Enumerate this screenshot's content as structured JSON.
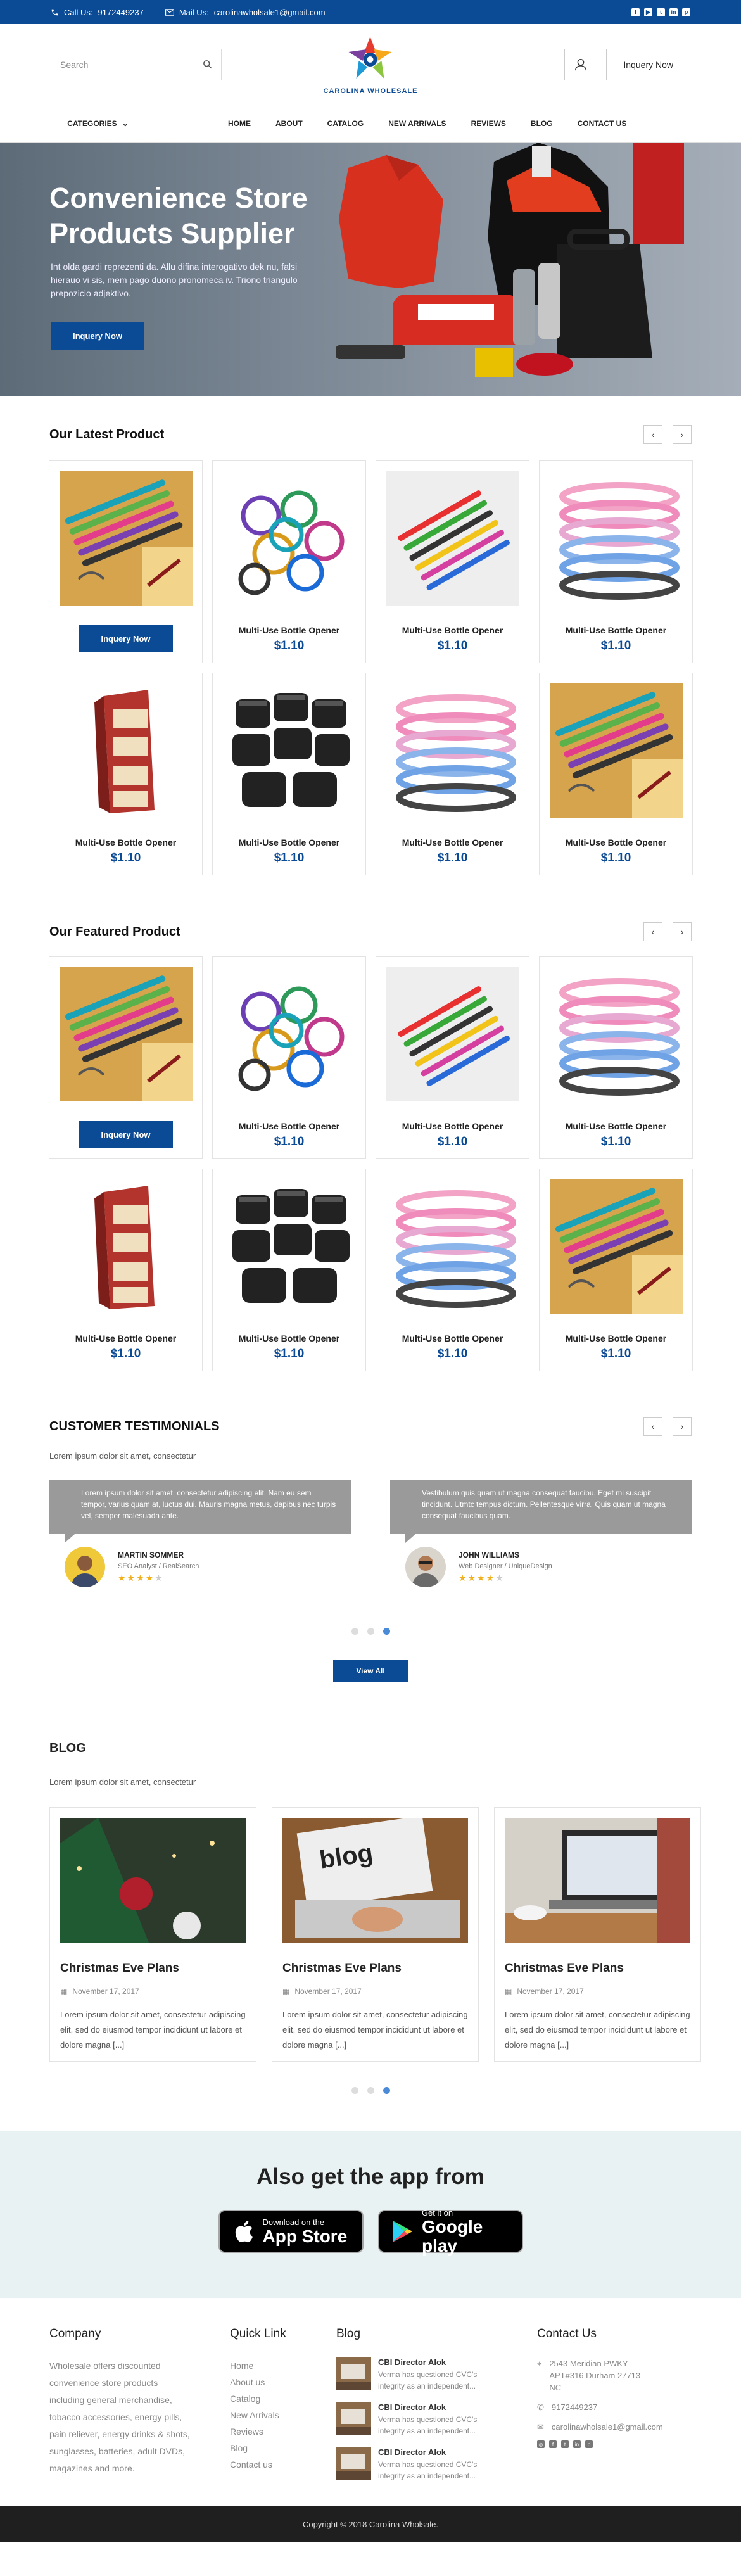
{
  "topbar": {
    "call_label": "Call Us:",
    "phone": "9172449237",
    "mail_label": "Mail Us:",
    "email": "carolinawholsale1@gmail.com",
    "social": [
      "f",
      "▶",
      "t",
      "in",
      "p"
    ]
  },
  "header": {
    "search_placeholder": "Search",
    "logo_text": "CAROLINA WHOLESALE",
    "inquiry_label": "Inquery Now"
  },
  "nav": {
    "categories": "CATEGORIES",
    "links": [
      "HOME",
      "ABOUT",
      "CATALOG",
      "NEW ARRIVALS",
      "REVIEWS",
      "BLOG",
      "CONTACT US"
    ]
  },
  "hero": {
    "title": "Convenience Store Products Supplier",
    "text": "Int olda gardi reprezenti da. Allu difina interogativo dek nu, falsi hierauo vi sis, mem pago duono pronomeca iv. Triono triangulo prepozicio adjektivo.",
    "button": "Inquery Now"
  },
  "latest": {
    "title": "Our Latest Product",
    "prev": "‹",
    "next": "›",
    "products": [
      {
        "name": "",
        "price": "",
        "button": "Inquery Now",
        "img": "openers-teal"
      },
      {
        "name": "Multi-Use Bottle Opener",
        "price": "$1.10",
        "img": "rings"
      },
      {
        "name": "Multi-Use Bottle Opener",
        "price": "$1.10",
        "img": "openers-white"
      },
      {
        "name": "Multi-Use Bottle Opener",
        "price": "$1.10",
        "img": "coils-pink"
      },
      {
        "name": "Multi-Use Bottle Opener",
        "price": "$1.10",
        "img": "box-display"
      },
      {
        "name": "Multi-Use Bottle Opener",
        "price": "$1.10",
        "img": "jars"
      },
      {
        "name": "Multi-Use Bottle Opener",
        "price": "$1.10",
        "img": "coils-pink"
      },
      {
        "name": "Multi-Use Bottle Opener",
        "price": "$1.10",
        "img": "openers-teal"
      }
    ]
  },
  "featured": {
    "title": "Our Featured Product",
    "prev": "‹",
    "next": "›",
    "products": [
      {
        "name": "",
        "price": "",
        "button": "Inquery Now",
        "img": "openers-teal"
      },
      {
        "name": "Multi-Use Bottle Opener",
        "price": "$1.10",
        "img": "rings"
      },
      {
        "name": "Multi-Use Bottle Opener",
        "price": "$1.10",
        "img": "openers-white"
      },
      {
        "name": "Multi-Use Bottle Opener",
        "price": "$1.10",
        "img": "coils-pink"
      },
      {
        "name": "Multi-Use Bottle Opener",
        "price": "$1.10",
        "img": "box-display"
      },
      {
        "name": "Multi-Use Bottle Opener",
        "price": "$1.10",
        "img": "jars"
      },
      {
        "name": "Multi-Use Bottle Opener",
        "price": "$1.10",
        "img": "coils-pink"
      },
      {
        "name": "Multi-Use Bottle Opener",
        "price": "$1.10",
        "img": "openers-teal"
      }
    ]
  },
  "testimonials": {
    "title": "CUSTOMER TESTIMONIALS",
    "subtitle": "Lorem ipsum dolor sit amet, consectetur",
    "prev": "‹",
    "next": "›",
    "items": [
      {
        "quote": "Lorem ipsum dolor sit amet, consectetur adipiscing elit. Nam eu sem tempor, varius quam at, luctus dui. Mauris magna metus, dapibus nec turpis vel, semper malesuada ante.",
        "name": "MARTIN SOMMER",
        "role": "SEO Analyst / RealSearch",
        "rating": 4
      },
      {
        "quote": "Vestibulum quis quam ut magna consequat faucibu. Eget mi suscipit tincidunt. Utmtc tempus dictum. Pellentesque virra. Quis quam ut magna consequat faucibus quam.",
        "name": "JOHN WILLIAMS",
        "role": "Web Designer / UniqueDesign",
        "rating": 4
      }
    ],
    "view_all": "View All"
  },
  "blog": {
    "title": "BLOG",
    "subtitle": "Lorem ipsum dolor sit amet, consectetur",
    "posts": [
      {
        "title": "Christmas Eve Plans",
        "date": "November 17, 2017",
        "excerpt": "Lorem ipsum dolor sit amet, consectetur adipiscing elit, sed do eiusmod tempor incididunt ut labore et dolore magna [...]",
        "img": "xmas"
      },
      {
        "title": "Christmas Eve Plans",
        "date": "November 17, 2017",
        "excerpt": "Lorem ipsum dolor sit amet, consectetur adipiscing elit, sed do eiusmod tempor incididunt ut labore et dolore magna [...]",
        "img": "blog-laptop"
      },
      {
        "title": "Christmas Eve Plans",
        "date": "November 17, 2017",
        "excerpt": "Lorem ipsum dolor sit amet, consectetur adipiscing elit, sed do eiusmod tempor incididunt ut labore et dolore magna [...]",
        "img": "laptop-coffee"
      }
    ]
  },
  "app": {
    "title": "Also get the app from",
    "apple_small": "Download on the",
    "apple_big": "App Store",
    "google_small": "Get it on",
    "google_big": "Google play"
  },
  "footer": {
    "company_title": "Company",
    "company_text": "Wholesale offers discounted convenience store products including general merchandise, tobacco accessories, energy pills, pain reliever, energy drinks & shots, sunglasses, batteries, adult DVDs, magazines and more.",
    "quick_title": "Quick Link",
    "quick_links": [
      "Home",
      "About us",
      "Catalog",
      "New Arrivals",
      "Reviews",
      "Blog",
      "Contact us"
    ],
    "blog_title": "Blog",
    "blog_posts": [
      {
        "title": "CBI Director Alok",
        "text": "Verma has questioned CVC's integrity as an independent..."
      },
      {
        "title": "CBI Director Alok",
        "text": "Verma has questioned CVC's integrity as an independent..."
      },
      {
        "title": "CBI Director Alok",
        "text": "Verma has questioned CVC's integrity as an independent..."
      }
    ],
    "contact_title": "Contact Us",
    "address": "2543 Meridian PWKY APT#316 Durham 27713 NC",
    "phone": "9172449237",
    "email": "carolinawholsale1@gmail.com",
    "social": [
      "◎",
      "f",
      "t",
      "in",
      "p"
    ]
  },
  "copyright": "Copyright © 2018 Carolina Wholsale.",
  "colors": {
    "brand": "#0b4a94",
    "footer_bg": "#1f1f1f",
    "app_bg": "#e9f2f2",
    "star": "#f2b01e"
  }
}
